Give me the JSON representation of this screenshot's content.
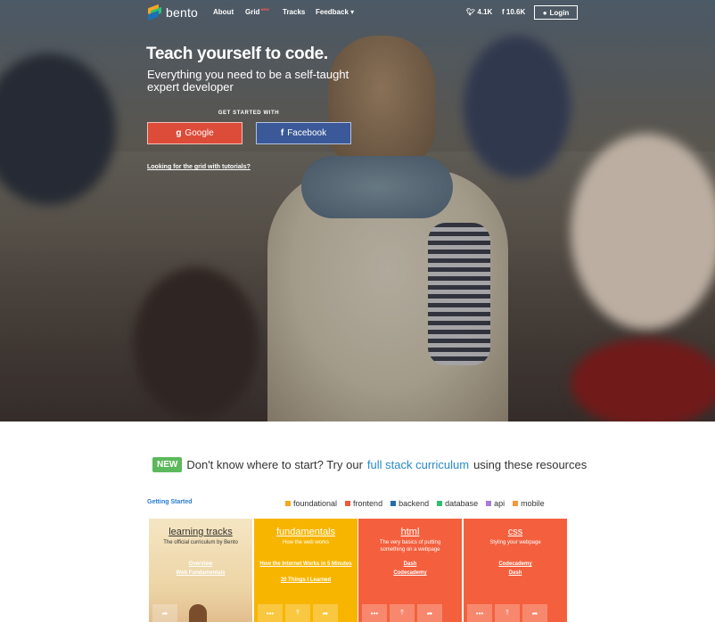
{
  "nav": {
    "logo_text": "bento",
    "items": [
      {
        "label": "About"
      },
      {
        "label": "Grid",
        "badge": "NEW"
      },
      {
        "label": "Tracks"
      },
      {
        "label": "Feedback ▾"
      }
    ],
    "twitter_count": "4.1K",
    "facebook_count": "10.6K",
    "login_label": "Login"
  },
  "hero": {
    "title": "Teach yourself to code.",
    "subtitle": "Everything you need to be a self-taught expert developer",
    "get_started": "GET STARTED WITH",
    "google_label": "Google",
    "facebook_label": "Facebook",
    "grid_link": "Looking for the grid with tutorials?"
  },
  "promo": {
    "badge": "NEW",
    "text_before": "Don't know where to start? Try our",
    "link": "full stack curriculum",
    "text_after": "using these resources"
  },
  "section": {
    "getting_started": "Getting Started"
  },
  "legend": [
    {
      "label": "foundational",
      "color": "#f5a623"
    },
    {
      "label": "frontend",
      "color": "#f15a3a"
    },
    {
      "label": "backend",
      "color": "#1f6fb2"
    },
    {
      "label": "database",
      "color": "#2fbf71"
    },
    {
      "label": "api",
      "color": "#a97bd8"
    },
    {
      "label": "mobile",
      "color": "#f59a3a"
    }
  ],
  "cards": [
    {
      "title": "learning tracks",
      "desc": "The official curriculum by Bento",
      "links": [
        "Overview",
        "Web Fundamentals"
      ],
      "color": "#f2e3bd"
    },
    {
      "title": "fundamentals",
      "desc": "How the web works",
      "links": [
        "How the Internet Works in 5 Minutes",
        "20 Things I Learned"
      ],
      "color": "#f7b500"
    },
    {
      "title": "html",
      "desc": "The very basics of putting something on a webpage",
      "links": [
        "Dash",
        "Codecademy"
      ],
      "color": "#f4603e"
    },
    {
      "title": "css",
      "desc": "Styling your webpage",
      "links": [
        "Codecademy",
        "Dash"
      ],
      "color": "#f4603e"
    }
  ],
  "card_actions": {
    "more": "•••",
    "upvote": "⤒",
    "share": "➦"
  }
}
